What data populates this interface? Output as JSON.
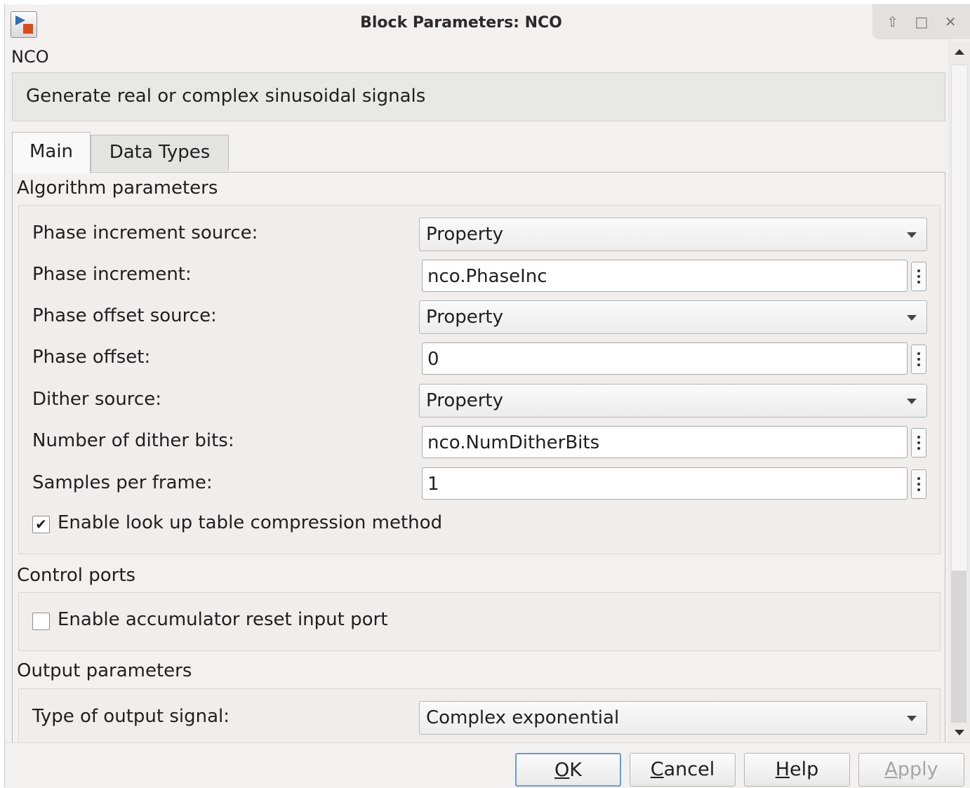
{
  "window": {
    "title": "Block Parameters: NCO"
  },
  "block": {
    "name": "NCO",
    "description": "Generate real or complex sinusoidal signals"
  },
  "tabs": [
    {
      "label": "Main",
      "active": true
    },
    {
      "label": "Data Types",
      "active": false
    }
  ],
  "algorithm": {
    "title": "Algorithm parameters",
    "phase_increment_source": {
      "label": "Phase increment source:",
      "value": "Property"
    },
    "phase_increment": {
      "label": "Phase increment:",
      "value": "nco.PhaseInc"
    },
    "phase_offset_source": {
      "label": "Phase offset source:",
      "value": "Property"
    },
    "phase_offset": {
      "label": "Phase offset:",
      "value": "0"
    },
    "dither_source": {
      "label": "Dither source:",
      "value": "Property"
    },
    "num_dither_bits": {
      "label": "Number of dither bits:",
      "value": "nco.NumDitherBits"
    },
    "samples_per_frame": {
      "label": "Samples per frame:",
      "value": "1"
    },
    "lut_compression": {
      "label": "Enable look up table compression method",
      "checked": true,
      "mark": "✔"
    }
  },
  "control_ports": {
    "title": "Control ports",
    "accumulator_reset": {
      "label": "Enable accumulator reset input port",
      "checked": false,
      "mark": ""
    }
  },
  "output": {
    "title": "Output parameters",
    "output_signal_type": {
      "label": "Type of output signal:",
      "value": "Complex exponential"
    }
  },
  "buttons": {
    "ok": {
      "mnemonic": "O",
      "rest": "K"
    },
    "cancel": {
      "mnemonic": "C",
      "rest": "ancel"
    },
    "help": {
      "mnemonic": "H",
      "rest": "elp"
    },
    "apply": {
      "mnemonic": "A",
      "rest": "pply",
      "disabled": true
    }
  },
  "window_controls": {
    "restore": "⇧",
    "maximize": "□",
    "close": "✕"
  }
}
